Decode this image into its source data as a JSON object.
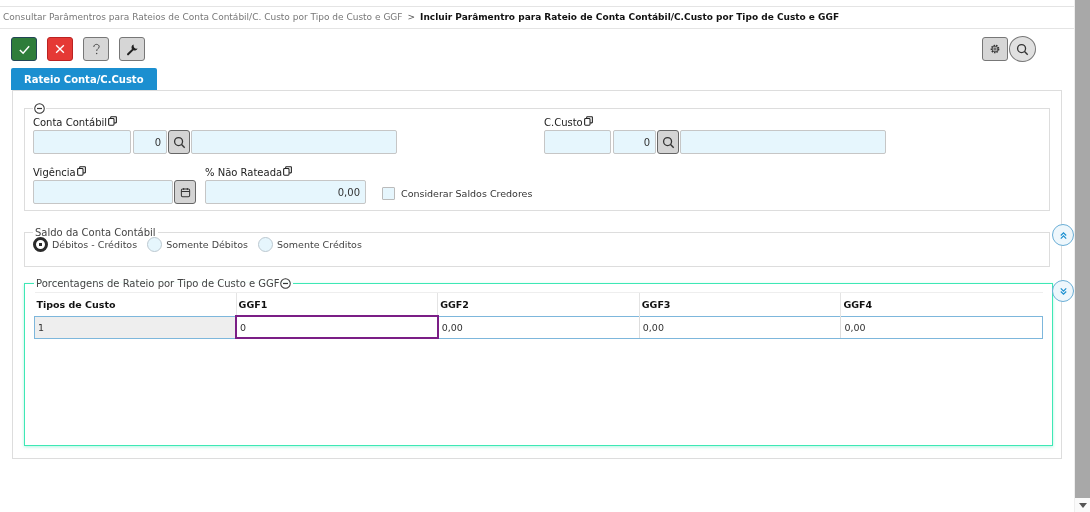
{
  "breadcrumb": {
    "parent": "Consultar Parâmentros para Rateios de Conta Contábil/C. Custo por Tipo de Custo e GGF",
    "separator": ">",
    "current": "Incluir Parâmentro para Rateio de Conta Contábil/C.Custo por Tipo de Custo e GGF"
  },
  "toolbar": [
    {
      "kind": "confirm"
    },
    {
      "kind": "cancel"
    },
    {
      "kind": "help"
    },
    {
      "kind": "tools"
    }
  ],
  "toolbar_right": [
    {
      "kind": "settings"
    },
    {
      "kind": "search"
    }
  ],
  "tabs": [
    {
      "label": "Rateio Conta/C.Custo",
      "selected": true
    }
  ],
  "main_section": {
    "conta_contabil": {
      "label": "Conta Contábil",
      "number": "0"
    },
    "c_custo": {
      "label": "C.Custo",
      "number": "0"
    },
    "vigencia": {
      "label": "Vigência"
    },
    "nao_rateada": {
      "label": "% Não Rateada",
      "value": "0,00"
    },
    "checkbox": {
      "label": "Considerar Saldos Credores",
      "checked": false
    }
  },
  "saldo": {
    "title": "Saldo da Conta Contábil",
    "options": [
      {
        "label": "Débitos - Créditos",
        "selected": true
      },
      {
        "label": "Somente Débitos",
        "selected": false
      },
      {
        "label": "Somente Créditos",
        "selected": false
      }
    ]
  },
  "porcentagens": {
    "title": "Porcentagens de Rateio por Tipo de Custo e GGF",
    "columns": [
      "Tipos de Custo",
      "GGF1",
      "GGF2",
      "GGF3",
      "GGF4"
    ],
    "rows": [
      {
        "cells": [
          {
            "text": "1",
            "focused": false
          },
          {
            "text": "0",
            "focused": true
          },
          {
            "text": "0,00",
            "focused": false
          },
          {
            "text": "0,00",
            "focused": false
          },
          {
            "text": "0,00",
            "focused": false
          }
        ]
      }
    ]
  }
}
